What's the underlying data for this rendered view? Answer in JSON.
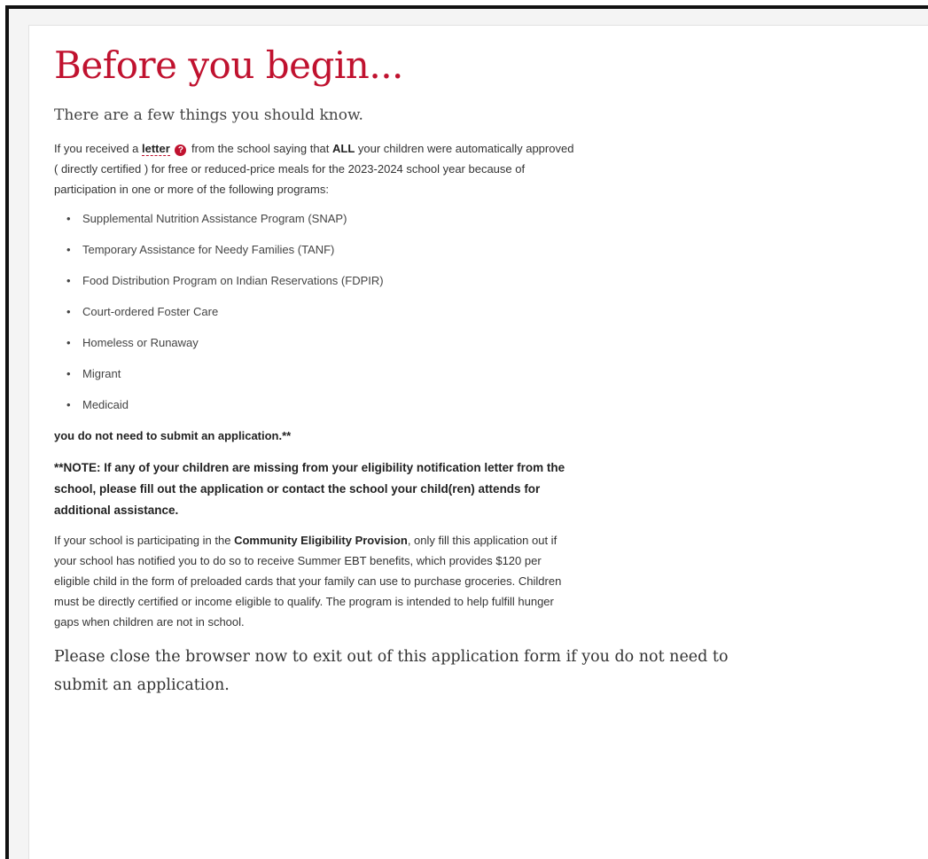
{
  "page": {
    "title": "Before you begin...",
    "subtitle": "There are a few things you should know."
  },
  "intro": {
    "part1": "If you received a ",
    "letter_link": "letter",
    "help_icon": "question-circle-icon",
    "part2": " from the school saying that ",
    "all_word": "ALL",
    "part3": " your children were automatically approved ( directly certified ) for free or reduced-price meals for the 2023-2024 school year because of participation in one or more of the following programs:"
  },
  "programs": [
    "Supplemental Nutrition Assistance Program (SNAP)",
    "Temporary Assistance for Needy Families (TANF)",
    "Food Distribution Program on Indian Reservations (FDPIR)",
    "Court-ordered Foster Care",
    "Homeless or Runaway",
    "Migrant",
    "Medicaid"
  ],
  "no_application_text": "you do not need to submit an application.**",
  "note_text": "**NOTE: If any of your children are missing from your eligibility notification letter from the school, please fill out the application or contact the school your child(ren) attends for additional assistance.",
  "cep": {
    "part1": "If your school is participating in the ",
    "bold": "Community Eligibility Provision",
    "part2": ", only fill this application out if your school has notified you to do so to receive Summer EBT benefits, which provides $120 per eligible child in the form of preloaded cards that your family can use to purchase groceries. Children must be directly certified or income eligible to qualify. The program is intended to help fulfill hunger gaps when children are not in school."
  },
  "closing_text": "Please close the browser now to exit out of this application form if you do not need to submit an application.",
  "colors": {
    "title": "#c0122f",
    "icon": "#c0122f"
  }
}
